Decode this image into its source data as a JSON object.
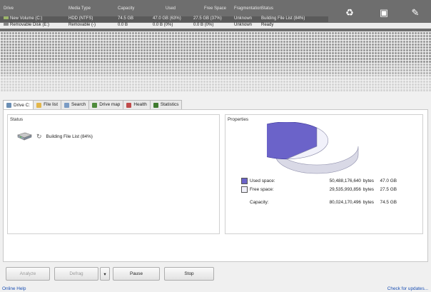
{
  "drive_list": {
    "columns": [
      "Drive",
      "Media Type",
      "Capacity",
      "Used",
      "Free Space",
      "Fragmentation",
      "Status"
    ],
    "rows": [
      {
        "drive": "New Volume (C:)",
        "media": "HDD (NTFS)",
        "capacity": "74.5 GB",
        "used": "47.0 GB (63%)",
        "free": "27.5 GB (37%)",
        "fragmentation": "Unknown",
        "status": "Building File List (84%)"
      },
      {
        "drive": "Removable Disk (E:)",
        "media": "Removable (-)",
        "capacity": "0.0 B",
        "used": "0.0 B (0%)",
        "free": "0.0 B (0%)",
        "fragmentation": "Unknown",
        "status": "Ready"
      }
    ]
  },
  "toolbar_icons": [
    "recycle-icon",
    "screen-icon",
    "pencil-icon"
  ],
  "tabs": [
    {
      "label": "Drive C:",
      "icon": "drive-icon",
      "color": "#6b8fb5"
    },
    {
      "label": "File list",
      "icon": "folder-icon",
      "color": "#e2b64a"
    },
    {
      "label": "Search",
      "icon": "search-icon",
      "color": "#7a9bc4"
    },
    {
      "label": "Drive map",
      "icon": "map-icon",
      "color": "#4f8c3c"
    },
    {
      "label": "Health",
      "icon": "health-icon",
      "color": "#c04b4b"
    },
    {
      "label": "Statistics",
      "icon": "chart-icon",
      "color": "#3e7a2e"
    }
  ],
  "status_section": {
    "title": "Status",
    "text": "Building File List (84%)"
  },
  "properties": {
    "title": "Properties",
    "used": {
      "label": "Used space:",
      "bytes": "50,488,176,640",
      "unit": "bytes",
      "size": "47.0 GB",
      "color": "#6b63c9"
    },
    "free": {
      "label": "Free space:",
      "bytes": "29,535,993,856",
      "unit": "bytes",
      "size": "27.5 GB",
      "color": "#f1f1fa"
    },
    "capacity": {
      "label": "Capacity:",
      "bytes": "80,024,170,496",
      "unit": "bytes",
      "size": "74.5 GB"
    },
    "used_fraction": 0.63
  },
  "buttons": {
    "analyze": "Analyze",
    "defrag": "Defrag",
    "pause": "Pause",
    "stop": "Stop"
  },
  "footer": {
    "help": "Online Help",
    "updates": "Check for updates..."
  }
}
